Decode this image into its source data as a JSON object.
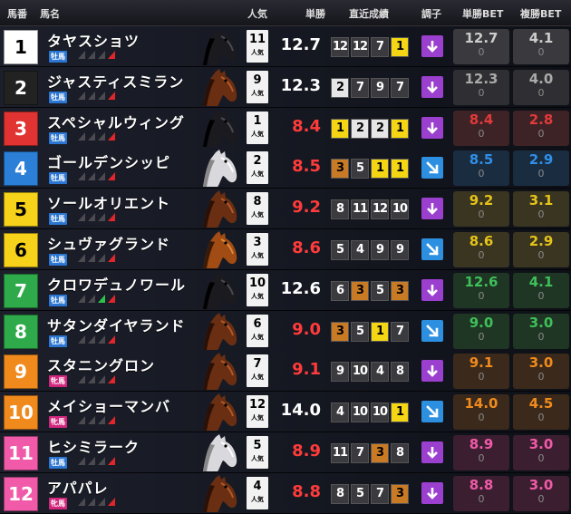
{
  "header": {
    "num": "馬番",
    "name": "馬名",
    "pop": "人気",
    "win": "単勝",
    "recent": "直近成績",
    "cond": "調子",
    "win_bet": "単勝BET",
    "place_bet": "複勝BET"
  },
  "pop_suffix": "人気",
  "colors": {
    "accent_up": "#2d8fe0",
    "accent_down": "#9b3fcf",
    "odds_red": "#ff3b3b",
    "sex_male": "#2a76d2",
    "sex_female": "#d2267d"
  },
  "horses": [
    {
      "num": "1",
      "num_bg": "#ffffff",
      "num_fg": "#000000",
      "name": "タヤスショツ",
      "sex": "牡馬",
      "cond_marks": [
        "gray",
        "gray",
        "gray",
        "red"
      ],
      "pop": "11",
      "win_odds": "12.7",
      "odds_color": "#ffffff",
      "recent": [
        "12",
        "12",
        "7",
        "1"
      ],
      "recent_cls": [
        "",
        "",
        "",
        "r1"
      ],
      "trend": "down",
      "horse_color": "black",
      "win_bet_odds": "12.7",
      "win_bet_count": "0",
      "place_bet_odds": "4.1",
      "place_bet_count": "0",
      "bet_bg": "#3a3a3e",
      "bet_fg": "#cccccc"
    },
    {
      "num": "2",
      "num_bg": "#222222",
      "num_fg": "#ffffff",
      "name": "ジャスティスミラン",
      "sex": "牡馬",
      "cond_marks": [
        "gray",
        "gray",
        "gray",
        "red"
      ],
      "pop": "9",
      "win_odds": "12.3",
      "odds_color": "#ffffff",
      "recent": [
        "2",
        "7",
        "9",
        "7"
      ],
      "recent_cls": [
        "r2",
        "",
        "",
        ""
      ],
      "trend": "down",
      "horse_color": "chestnut",
      "win_bet_odds": "12.3",
      "win_bet_count": "0",
      "place_bet_odds": "4.0",
      "place_bet_count": "0",
      "bet_bg": "#2f2f33",
      "bet_fg": "#aaaaaa"
    },
    {
      "num": "3",
      "num_bg": "#e23333",
      "num_fg": "#ffffff",
      "name": "スペシャルウィング",
      "sex": "牡馬",
      "cond_marks": [
        "gray",
        "gray",
        "gray",
        "red"
      ],
      "pop": "1",
      "win_odds": "8.4",
      "odds_color": "#ff3b3b",
      "recent": [
        "1",
        "2",
        "2",
        "1"
      ],
      "recent_cls": [
        "r1",
        "r2",
        "r2",
        "r1"
      ],
      "trend": "down",
      "horse_color": "black",
      "win_bet_odds": "8.4",
      "win_bet_count": "0",
      "place_bet_odds": "2.8",
      "place_bet_count": "0",
      "bet_bg": "#3d2226",
      "bet_fg": "#e23a3a"
    },
    {
      "num": "4",
      "num_bg": "#2b7fd6",
      "num_fg": "#ffffff",
      "name": "ゴールデンシッピ",
      "sex": "牡馬",
      "cond_marks": [
        "gray",
        "gray",
        "gray",
        "red"
      ],
      "pop": "2",
      "win_odds": "8.5",
      "odds_color": "#ff3b3b",
      "recent": [
        "3",
        "5",
        "1",
        "1"
      ],
      "recent_cls": [
        "r3",
        "",
        "r1",
        "r1"
      ],
      "trend": "up",
      "horse_color": "white",
      "win_bet_odds": "8.5",
      "win_bet_count": "0",
      "place_bet_odds": "2.9",
      "place_bet_count": "0",
      "bet_bg": "#1a2c40",
      "bet_fg": "#2f8fe6"
    },
    {
      "num": "5",
      "num_bg": "#f6d21a",
      "num_fg": "#000000",
      "name": "ソールオリエント",
      "sex": "牡馬",
      "cond_marks": [
        "gray",
        "gray",
        "gray",
        "red"
      ],
      "pop": "8",
      "win_odds": "9.2",
      "odds_color": "#ff3b3b",
      "recent": [
        "8",
        "11",
        "12",
        "10"
      ],
      "recent_cls": [
        "",
        "",
        "",
        ""
      ],
      "trend": "down",
      "horse_color": "chestnut",
      "win_bet_odds": "9.2",
      "win_bet_count": "0",
      "place_bet_odds": "3.1",
      "place_bet_count": "0",
      "bet_bg": "#3a3520",
      "bet_fg": "#e6c319"
    },
    {
      "num": "6",
      "num_bg": "#f6d21a",
      "num_fg": "#000000",
      "name": "シュヴァグランド",
      "sex": "牡馬",
      "cond_marks": [
        "gray",
        "gray",
        "gray",
        "red"
      ],
      "pop": "3",
      "win_odds": "8.6",
      "odds_color": "#ff3b3b",
      "recent": [
        "5",
        "4",
        "9",
        "9"
      ],
      "recent_cls": [
        "",
        "",
        "",
        ""
      ],
      "trend": "up",
      "horse_color": "orange",
      "win_bet_odds": "8.6",
      "win_bet_count": "0",
      "place_bet_odds": "2.9",
      "place_bet_count": "0",
      "bet_bg": "#3a3520",
      "bet_fg": "#e6c319"
    },
    {
      "num": "7",
      "num_bg": "#2faa4a",
      "num_fg": "#ffffff",
      "name": "クロワデュノワール",
      "sex": "牡馬",
      "cond_marks": [
        "gray",
        "gray",
        "green",
        "red"
      ],
      "pop": "10",
      "win_odds": "12.6",
      "odds_color": "#ffffff",
      "recent": [
        "6",
        "3",
        "5",
        "3"
      ],
      "recent_cls": [
        "",
        "r3",
        "",
        "r3"
      ],
      "trend": "down",
      "horse_color": "black",
      "win_bet_odds": "12.6",
      "win_bet_count": "0",
      "place_bet_odds": "4.1",
      "place_bet_count": "0",
      "bet_bg": "#1f3624",
      "bet_fg": "#3fbf5a"
    },
    {
      "num": "8",
      "num_bg": "#2faa4a",
      "num_fg": "#ffffff",
      "name": "サタンダイヤランド",
      "sex": "牡馬",
      "cond_marks": [
        "gray",
        "gray",
        "gray",
        "red"
      ],
      "pop": "6",
      "win_odds": "9.0",
      "odds_color": "#ff3b3b",
      "recent": [
        "3",
        "5",
        "1",
        "7"
      ],
      "recent_cls": [
        "r3",
        "",
        "r1",
        ""
      ],
      "trend": "up",
      "horse_color": "chestnut",
      "win_bet_odds": "9.0",
      "win_bet_count": "0",
      "place_bet_odds": "3.0",
      "place_bet_count": "0",
      "bet_bg": "#1f3624",
      "bet_fg": "#3fbf5a"
    },
    {
      "num": "9",
      "num_bg": "#f08a1d",
      "num_fg": "#ffffff",
      "name": "スタニングロン",
      "sex": "牝馬",
      "cond_marks": [
        "gray",
        "gray",
        "gray",
        "red"
      ],
      "pop": "7",
      "win_odds": "9.1",
      "odds_color": "#ff3b3b",
      "recent": [
        "9",
        "10",
        "4",
        "8"
      ],
      "recent_cls": [
        "",
        "",
        "",
        ""
      ],
      "trend": "down",
      "horse_color": "chestnut",
      "win_bet_odds": "9.1",
      "win_bet_count": "0",
      "place_bet_odds": "3.0",
      "place_bet_count": "0",
      "bet_bg": "#3b2a1b",
      "bet_fg": "#f08a1d"
    },
    {
      "num": "10",
      "num_bg": "#f08a1d",
      "num_fg": "#ffffff",
      "name": "メイショーマンバ",
      "sex": "牝馬",
      "cond_marks": [
        "gray",
        "gray",
        "gray",
        "red"
      ],
      "pop": "12",
      "win_odds": "14.0",
      "odds_color": "#ffffff",
      "recent": [
        "4",
        "10",
        "10",
        "1"
      ],
      "recent_cls": [
        "",
        "",
        "",
        "r1"
      ],
      "trend": "up",
      "horse_color": "chestnut",
      "win_bet_odds": "14.0",
      "win_bet_count": "0",
      "place_bet_odds": "4.5",
      "place_bet_count": "0",
      "bet_bg": "#3b2a1b",
      "bet_fg": "#f08a1d"
    },
    {
      "num": "11",
      "num_bg": "#f05aa8",
      "num_fg": "#ffffff",
      "name": "ヒシミラーク",
      "sex": "牡馬",
      "cond_marks": [
        "gray",
        "gray",
        "gray",
        "red"
      ],
      "pop": "5",
      "win_odds": "8.9",
      "odds_color": "#ff3b3b",
      "recent": [
        "11",
        "7",
        "3",
        "8"
      ],
      "recent_cls": [
        "",
        "",
        "r3",
        ""
      ],
      "trend": "down",
      "horse_color": "white",
      "win_bet_odds": "8.9",
      "win_bet_count": "0",
      "place_bet_odds": "3.0",
      "place_bet_count": "0",
      "bet_bg": "#3b1f30",
      "bet_fg": "#f05aa8"
    },
    {
      "num": "12",
      "num_bg": "#f05aa8",
      "num_fg": "#ffffff",
      "name": "アパパレ",
      "sex": "牝馬",
      "cond_marks": [
        "gray",
        "gray",
        "gray",
        "red"
      ],
      "pop": "4",
      "win_odds": "8.8",
      "odds_color": "#ff3b3b",
      "recent": [
        "8",
        "5",
        "7",
        "3"
      ],
      "recent_cls": [
        "",
        "",
        "",
        "r3"
      ],
      "trend": "down",
      "horse_color": "chestnut",
      "win_bet_odds": "8.8",
      "win_bet_count": "0",
      "place_bet_odds": "3.0",
      "place_bet_count": "0",
      "bet_bg": "#3b1f30",
      "bet_fg": "#f05aa8"
    }
  ]
}
